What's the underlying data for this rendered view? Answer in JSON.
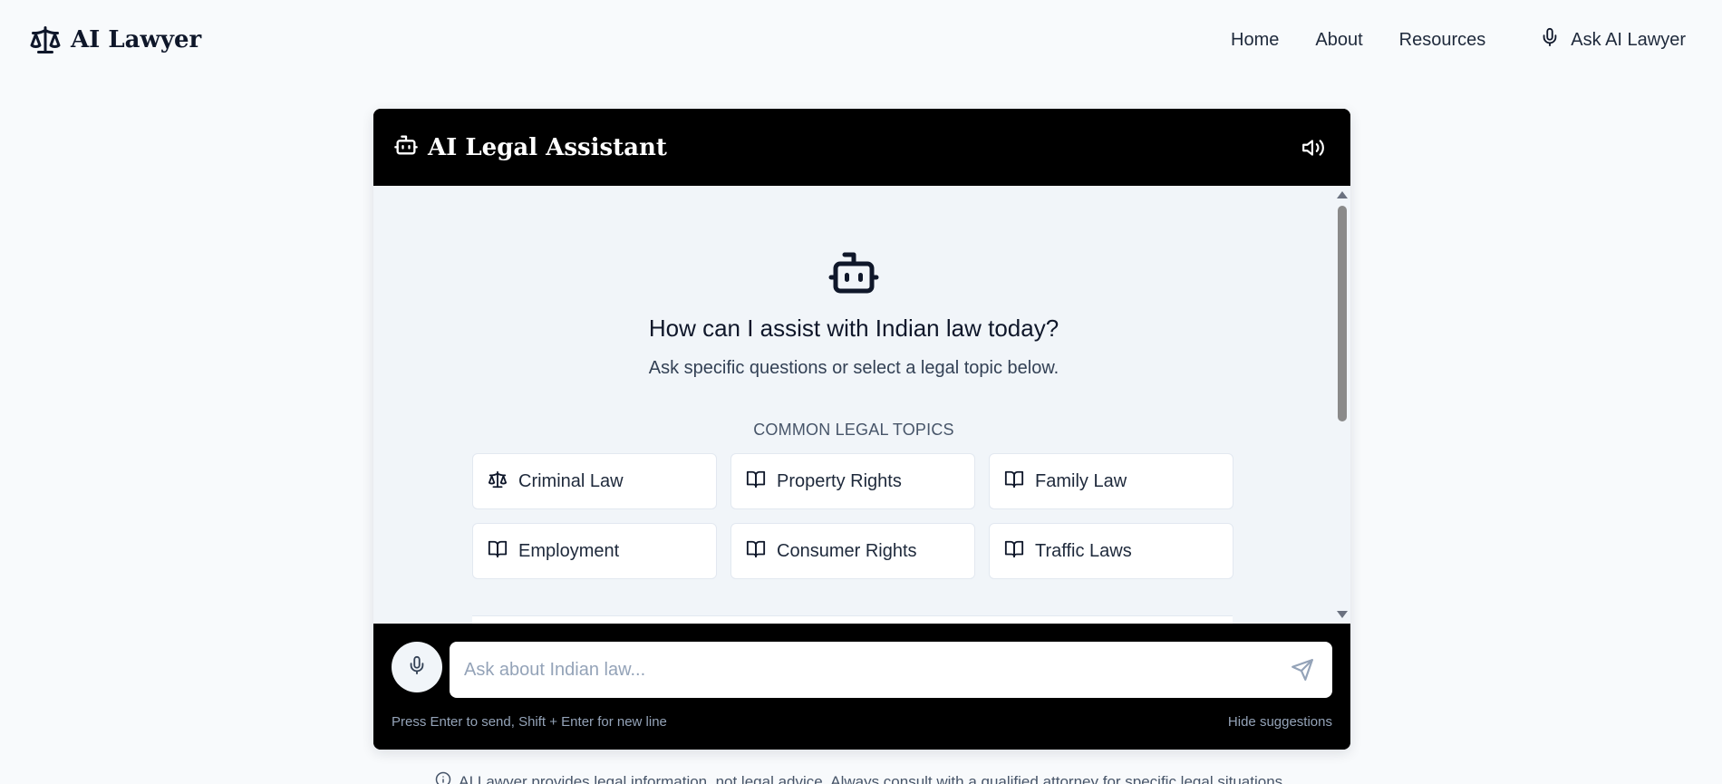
{
  "nav": {
    "brand": "AI Lawyer",
    "links": [
      "Home",
      "About",
      "Resources"
    ],
    "ask_button": "Ask AI Lawyer"
  },
  "chat": {
    "title": "AI Legal Assistant",
    "welcome_title": "How can I assist with Indian law today?",
    "welcome_subtitle": "Ask specific questions or select a legal topic below.",
    "topics_heading": "COMMON LEGAL TOPICS",
    "topics": [
      {
        "label": "Criminal Law",
        "icon": "scale-icon"
      },
      {
        "label": "Property Rights",
        "icon": "book-icon"
      },
      {
        "label": "Family Law",
        "icon": "book-icon"
      },
      {
        "label": "Employment",
        "icon": "book-icon"
      },
      {
        "label": "Consumer Rights",
        "icon": "book-icon"
      },
      {
        "label": "Traffic Laws",
        "icon": "book-icon"
      }
    ],
    "input_placeholder": "Ask about Indian law...",
    "input_value": "",
    "hint": "Press Enter to send, Shift + Enter for new line",
    "hide_suggestions": "Hide suggestions"
  },
  "disclaimer": "AI Lawyer provides legal information, not legal advice. Always consult with a qualified attorney for specific legal situations.",
  "colors": {
    "page_bg": "#f8fafc",
    "header_bg": "#000000",
    "chat_bg": "#f1f5f9",
    "text_primary": "#0f172a"
  }
}
